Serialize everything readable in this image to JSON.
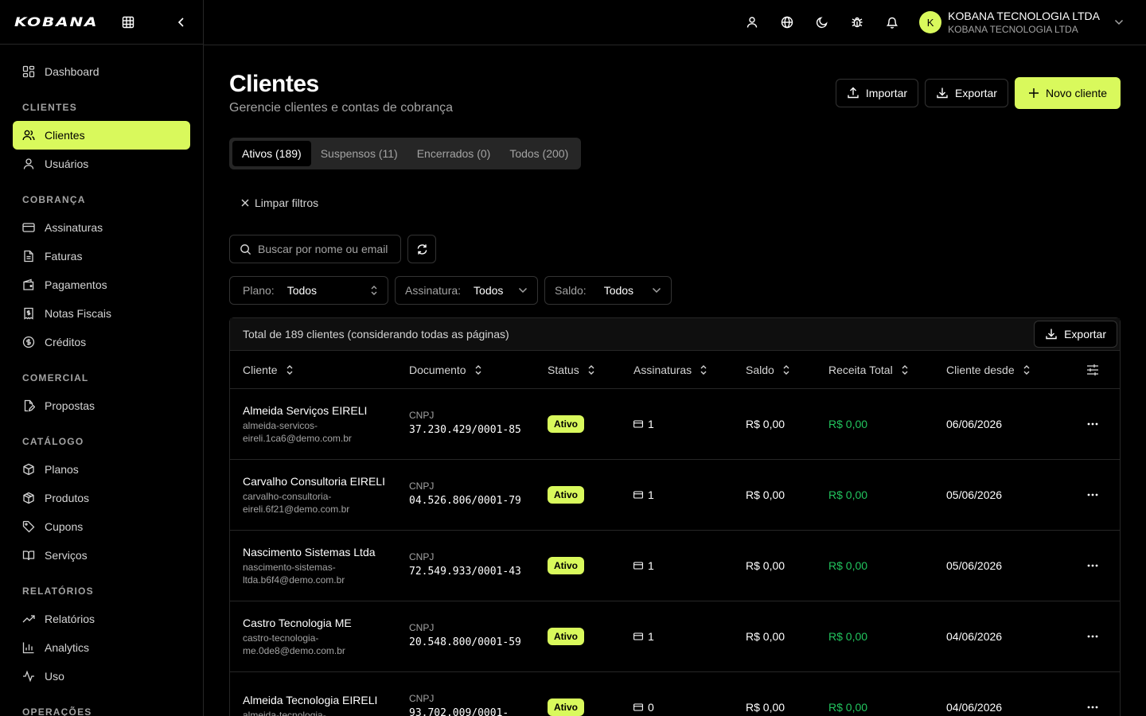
{
  "brand": {
    "logo": "KOBANA"
  },
  "sidebar": {
    "dashboard": "Dashboard",
    "sections": [
      {
        "title": "CLIENTES",
        "items": [
          {
            "label": "Clientes",
            "icon": "users-icon",
            "active": true
          },
          {
            "label": "Usuários",
            "icon": "user-icon"
          }
        ]
      },
      {
        "title": "COBRANÇA",
        "items": [
          {
            "label": "Assinaturas",
            "icon": "card-icon"
          },
          {
            "label": "Faturas",
            "icon": "file-icon"
          },
          {
            "label": "Pagamentos",
            "icon": "wallet-icon"
          },
          {
            "label": "Notas Fiscais",
            "icon": "receipt-icon"
          },
          {
            "label": "Créditos",
            "icon": "dollar-icon"
          }
        ]
      },
      {
        "title": "COMERCIAL",
        "items": [
          {
            "label": "Propostas",
            "icon": "file-signature-icon"
          }
        ]
      },
      {
        "title": "CATÁLOGO",
        "items": [
          {
            "label": "Planos",
            "icon": "box-icon"
          },
          {
            "label": "Produtos",
            "icon": "package-icon"
          },
          {
            "label": "Cupons",
            "icon": "tag-icon"
          },
          {
            "label": "Serviços",
            "icon": "book-icon"
          }
        ]
      },
      {
        "title": "RELATÓRIOS",
        "items": [
          {
            "label": "Relatórios",
            "icon": "trending-icon"
          },
          {
            "label": "Analytics",
            "icon": "bar-chart-icon"
          },
          {
            "label": "Uso",
            "icon": "activity-icon"
          }
        ]
      },
      {
        "title": "OPERAÇÕES",
        "items": []
      }
    ]
  },
  "account": {
    "initial": "K",
    "name": "KOBANA TECNOLOGIA LTDA",
    "org": "KOBANA TECNOLOGIA LTDA"
  },
  "page": {
    "title": "Clientes",
    "subtitle": "Gerencie clientes e contas de cobrança",
    "import_label": "Importar",
    "export_label": "Exportar",
    "new_label": "Novo cliente"
  },
  "tabs": [
    "Ativos (189)",
    "Suspensos (11)",
    "Encerrados (0)",
    "Todos (200)"
  ],
  "clear_filters": "Limpar filtros",
  "search": {
    "placeholder": "Buscar por nome ou email"
  },
  "filters": [
    {
      "label": "Plano:",
      "value": "Todos"
    },
    {
      "label": "Assinatura:",
      "value": "Todos"
    },
    {
      "label": "Saldo:",
      "value": "Todos"
    }
  ],
  "table": {
    "total": "Total de 189 clientes (considerando todas as páginas)",
    "export_label": "Exportar",
    "headers": [
      "Cliente",
      "Documento",
      "Status",
      "Assinaturas",
      "Saldo",
      "Receita Total",
      "Cliente desde"
    ],
    "rows": [
      {
        "name": "Almeida Serviços EIRELI",
        "email": "almeida-servicos-eireli.1ca6@demo.com.br",
        "doc_type": "CNPJ",
        "doc": "37.230.429/0001-85",
        "status": "Ativo",
        "subs": "1",
        "saldo": "R$ 0,00",
        "receita": "R$ 0,00",
        "since": "06/06/2026"
      },
      {
        "name": "Carvalho Consultoria EIRELI",
        "email": "carvalho-consultoria-eireli.6f21@demo.com.br",
        "doc_type": "CNPJ",
        "doc": "04.526.806/0001-79",
        "status": "Ativo",
        "subs": "1",
        "saldo": "R$ 0,00",
        "receita": "R$ 0,00",
        "since": "05/06/2026"
      },
      {
        "name": "Nascimento Sistemas Ltda",
        "email": "nascimento-sistemas-ltda.b6f4@demo.com.br",
        "doc_type": "CNPJ",
        "doc": "72.549.933/0001-43",
        "status": "Ativo",
        "subs": "1",
        "saldo": "R$ 0,00",
        "receita": "R$ 0,00",
        "since": "05/06/2026"
      },
      {
        "name": "Castro Tecnologia ME",
        "email": "castro-tecnologia-me.0de8@demo.com.br",
        "doc_type": "CNPJ",
        "doc": "20.548.800/0001-59",
        "status": "Ativo",
        "subs": "1",
        "saldo": "R$ 0,00",
        "receita": "R$ 0,00",
        "since": "04/06/2026"
      },
      {
        "name": "Almeida Tecnologia EIRELI",
        "email": "almeida-tecnologia-",
        "doc_type": "CNPJ",
        "doc": "93.702.009/0001-",
        "status": "Ativo",
        "subs": "0",
        "saldo": "R$ 0,00",
        "receita": "R$ 0,00",
        "since": "04/06/2026"
      }
    ]
  },
  "colors": {
    "accent": "#d9f95c",
    "positive": "#22c55e",
    "border": "#262626"
  }
}
